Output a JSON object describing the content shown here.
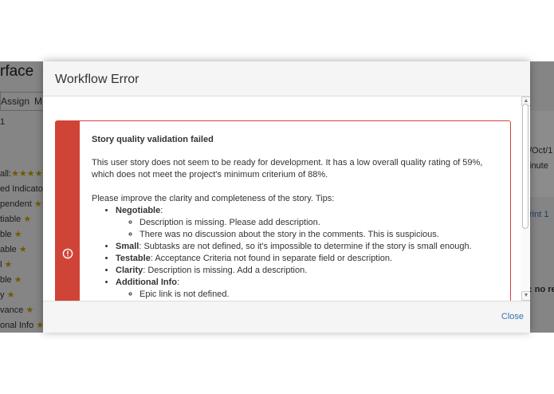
{
  "background": {
    "page_title_fragment": "rface",
    "toolbar": {
      "assign_label": "Assign",
      "next_label": "M"
    },
    "left_tab_fragment": "1",
    "left_list": [
      {
        "label": "all:",
        "stars": "★★★★★"
      },
      {
        "label": "ed Indicator",
        "stars": ""
      },
      {
        "label": "pendent",
        "stars": "★"
      },
      {
        "label": "tiable",
        "stars": "★"
      },
      {
        "label": "ble",
        "stars": "★"
      },
      {
        "label": "able",
        "stars": "★"
      },
      {
        "label": "l",
        "stars": "★"
      },
      {
        "label": "ble",
        "stars": "★"
      },
      {
        "label": "y",
        "stars": "★"
      },
      {
        "label": "vance",
        "stars": "★"
      },
      {
        "label": "onal Info",
        "stars": "★"
      }
    ],
    "right_fragments": {
      "date": "/Oct/1",
      "minute": "inute",
      "sprint": "rint 1",
      "no_results": ": no re"
    },
    "star_color": "#c8a400"
  },
  "dialog": {
    "title": "Workflow Error",
    "error": {
      "heading": "Story quality validation failed",
      "intro": "This user story does not seem to be ready for development. It has a low overall quality rating of 59%, which does not meet the project's minimum criterium of 88%.",
      "tips_intro": "Please improve the clarity and completeness of the story. Tips:",
      "tips": {
        "negotiable": {
          "label": "Negotiable",
          "items": [
            "Description is missing. Please add description.",
            "There was no discussion about the story in the comments. This is suspicious."
          ]
        },
        "small": {
          "label": "Small",
          "text": ": Subtasks are not defined, so it's impossible to determine if the story is small enough."
        },
        "testable": {
          "label": "Testable",
          "text": ": Acceptance Criteria not found in separate field or description."
        },
        "clarity": {
          "label": "Clarity",
          "text": ": Description is missing. Add a description."
        },
        "additional": {
          "label": "Additional Info",
          "items": [
            "Epic link is not defined."
          ]
        }
      },
      "accent_color": "#d04437"
    },
    "close_label": "Close",
    "link_color": "#3572b0"
  }
}
